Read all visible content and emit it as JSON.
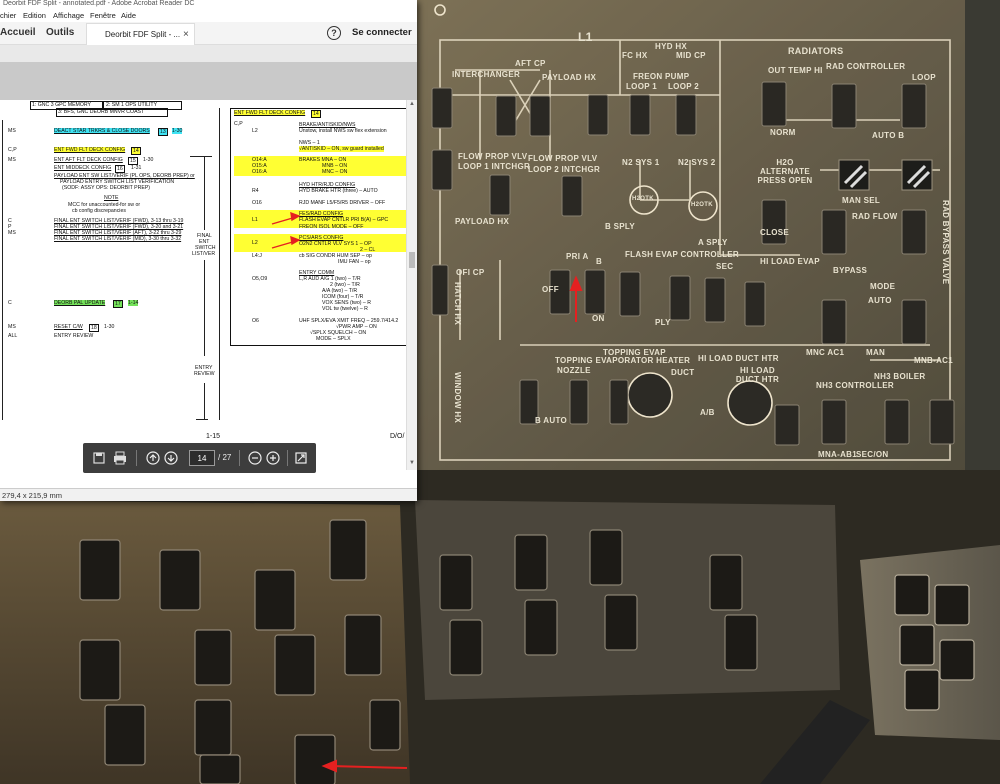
{
  "window": {
    "title": "Deorbit FDF Split - annotated.pdf - Adobe Acrobat Reader DC",
    "menu": [
      "chier",
      "Edition",
      "Affichage",
      "Fenêtre",
      "Aide"
    ],
    "nav_home": "Accueil",
    "nav_tools": "Outils",
    "doc_tab": "Deorbit FDF Split - ...",
    "doc_tab_close": "×",
    "help": "?",
    "signin": "Se connecter",
    "page_size": "279,4 x 215,9 mm"
  },
  "page_control": {
    "current_page": "14",
    "total_pages": "/ 27"
  },
  "document": {
    "page_footer": "1-15",
    "footer_right": "D/O/",
    "left": {
      "header_box_1": "1: GNC 3 GPC MEMORY",
      "header_box_2": "2: SM 1 OPS UTILITY",
      "header_box_3": "3: BFS, GNC DEORB MNVR COAST",
      "rows": [
        {
          "who": "MS",
          "text": "DEACT STAR TRKRS & CLOSE DOORS",
          "ref": "13",
          "page": "1-30",
          "hl": "cyan"
        },
        {
          "who": "C,P",
          "text": "ENT FWD FLT DECK CONFIG",
          "ref": "14",
          "page": "",
          "hl": "yellow"
        },
        {
          "who": "MS",
          "text": "ENT AFT FLT DECK CONFIG",
          "ref": "15",
          "page": "1-30",
          "hl": ""
        },
        {
          "who": "",
          "text": "ENT MIDDECK CONFIG",
          "ref": "16",
          "page": "1-31",
          "hl": ""
        }
      ],
      "payload_line_1": "PAYLOAD ENT SW LIST/VERIF (PL OPS, DEORB PREP) or",
      "payload_line_2": "PAYLOAD ENTRY SWITCH LIST VERIFICATION",
      "payload_line_3": "(SODF: ASSY OPS: DEORBIT PREP)",
      "note_title": "NOTE",
      "note_line_1": "MCC for unaccounted-for sw or",
      "note_line_2": "cb config discrepancies",
      "sw_rows": [
        {
          "who": "C",
          "text": "FINAL ENT SWITCH LIST/VERIF (FWD), 3-13 thru 3-19"
        },
        {
          "who": "P",
          "text": "FINAL ENT SWITCH LIST/VERIF (FWD), 3-20 and 3-21"
        },
        {
          "who": "MS",
          "text": "FINAL ENT SWITCH LIST/VERIF (AFT), 3-22 thru 3-29"
        },
        {
          "who": "",
          "text": "FINAL ENT SWITCH LIST/VERIF (MID), 3-30 thru 3-32"
        }
      ],
      "side_label_1": "FINAL",
      "side_label_2": "ENT",
      "side_label_3": "SWITCH",
      "side_label_4": "LIST/VER",
      "pal_who": "C",
      "pal_text": "DEORB PAL UPDATE",
      "pal_ref": "17",
      "pal_page": "1-14",
      "reset_who": "MS",
      "reset_text": "RESET C/W",
      "reset_ref": "18",
      "reset_page": "1-30",
      "all_who": "ALL",
      "all_text": "ENTRY REVIEW",
      "entry_review_1": "ENTRY",
      "entry_review_2": "REVIEW"
    },
    "right": {
      "title": "ENT FWD FLT DECK CONFIG",
      "title_ref": "14",
      "cp": "C,P",
      "l2": "L2",
      "brake_title": "BRAKE/ANTISKID/NWS",
      "brake_text": "Unstow, install NWS sw flex extension",
      "nws": "NWS – 1",
      "antiskid": "√ANTISKID – ON, sw guard installed",
      "o14": "O14:A",
      "o15": "O15:A",
      "o16": "O16:A",
      "brakes1": "BRAKES MNA – ON",
      "brakes2": "MNB – ON",
      "brakes3": "MNC – ON",
      "r4": "R4",
      "hyd_title": "HYD HTR/RJD CONFIG",
      "hyd_text": "HYD BRAKE HTR (three) – AUTO",
      "o16b": "O16",
      "rjd_text": "RJD MANF L5/F5/R5 DRIVER – OFF",
      "l1": "L1",
      "fes_title": "FES/RAD CONFIG",
      "fes_text": "FLASH EVAP CNTLR PRI B(A) – GPC",
      "freon_text": "FREON ISOL MODE – OFF",
      "l2b": "L2",
      "pcs_title": "PCS/ARS CONFIG",
      "pcs_text": "O2N2 CNTLR VLV SYS 1 – OP",
      "pcs_text_2": "2 – CL",
      "l4j": "L4:J",
      "cb_text": "cb SIG CONDR HUM SEP – op",
      "imu_text": "IMU FAN – op",
      "comm_title": "ENTRY COMM",
      "o509": "O5,O9",
      "comm_1": "L,R AUD A/G 1 (two) – T/R",
      "comm_2": "2 (two) – T/R",
      "comm_3": "A/A (two) – T/R",
      "comm_4": "ICOM (four) – T/R",
      "comm_5": "VOX SENS (two) – R",
      "comm_6": "VOL tw (twelve) – R",
      "o6": "O6",
      "uhf_1": "UHF SPLX/EVA XMIT FREQ – 259.7/414.2",
      "uhf_2": "√PWR AMP – ON",
      "uhf_3": "√SPLX SQUELCH – ON",
      "uhf_4": "MODE – SPLX"
    }
  },
  "panel_labels": {
    "l1": "L1",
    "hyd_hx": "HYD HX",
    "fc_hx": "FC HX",
    "mid_cp": "MID CP",
    "aft_cp": "AFT CP",
    "interchanger": "INTERCHANGER",
    "payload_hx": "PAYLOAD HX",
    "freon_pump": "FREON PUMP",
    "loop1": "LOOP 1",
    "loop2": "LOOP 2",
    "radiators": "RADIATORS",
    "out_temp_hi": "OUT TEMP HI",
    "rad_controller": "RAD CONTROLLER",
    "loop": "LOOP",
    "norm": "NORM",
    "auto_b": "AUTO B",
    "flow_prop_vlv_1": "FLOW PROP VLV",
    "loop_1_intchgr": "LOOP 1 INTCHGR",
    "flow_prop_vlv_2": "FLOW PROP VLV",
    "loop_2_intchgr": "LOOP 2 INTCHGR",
    "n2_sys1": "N2 SYS 1",
    "n2_sys2": "N2 SYS 2",
    "h2o_alt_press": "H2O ALTERNATE PRESS OPEN",
    "man_sel": "MAN SEL",
    "rad_flow": "RAD FLOW",
    "payload_hx_2": "PAYLOAD HX",
    "h2otk_b": "H2OTK",
    "h2otk_a": "H2OTK",
    "b_sply": "B SPLY",
    "a_sply": "A SPLY",
    "close": "CLOSE",
    "flash_evap_ctlr": "FLASH EVAP CONTROLLER",
    "pri_a": "PRI A",
    "b": "B",
    "sec": "SEC",
    "hi_load_evap": "HI LOAD EVAP",
    "bypass": "BYPASS",
    "mode": "MODE",
    "auto": "AUTO",
    "man": "MAN",
    "on": "ON",
    "off": "OFF",
    "ply": "PLY",
    "topping_evap": "TOPPING EVAP",
    "hi_load_duct_htr": "HI LOAD DUCT HTR",
    "topping_evap_heater": "TOPPING EVAPORATOR HEATER",
    "nozzle": "NOZZLE",
    "duct": "DUCT",
    "hi_load": "HI LOAD DUCT HTR",
    "nh3_boiler": "NH3 BOILER",
    "nh3_controller": "NH3 CONTROLLER",
    "sec_on": "SEC/ON",
    "b_auto": "B AUTO",
    "a_b": "A/B",
    "rad_bypass_valve": "RAD BYPASS VALVE",
    "hatch_hx": "HATCH HX",
    "window_hx": "WINDOW HX",
    "ofi_cp": "OFI CP",
    "mnc_ac1": "MNC AC1",
    "mnb_ac1": "MNB-AC1",
    "mna_ac1": "MNA-AB1"
  }
}
